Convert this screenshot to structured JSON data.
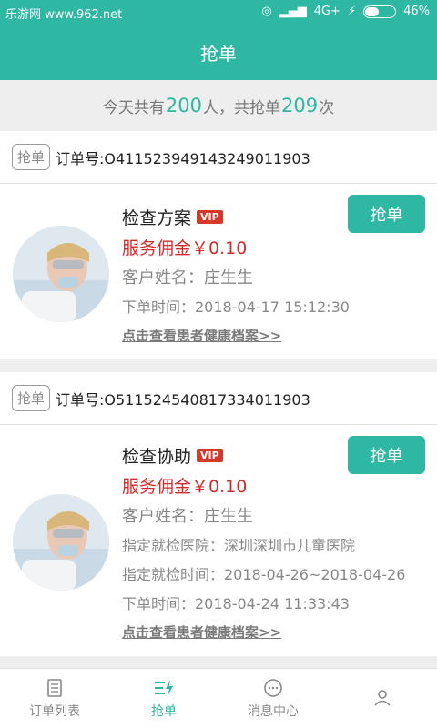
{
  "statusbar": {
    "watermark": "乐游网 www.962.net",
    "network": "4G+",
    "battery": "46%",
    "battery_level": 0.46
  },
  "header": {
    "title": "抢单"
  },
  "summary": {
    "prefix": "今天共有",
    "people": "200",
    "mid": "人，共抢单",
    "times": "209",
    "suffix": "次"
  },
  "orders": [
    {
      "tag": "抢单",
      "order_no": "订单号:O411523949143249011903",
      "title": "检查方案",
      "vip": "VIP",
      "fee": "服务佣金￥0.10",
      "customer": "客户姓名：庄生生",
      "lines": [
        "下单时间：2018-04-17 15:12:30"
      ],
      "link": "点击查看患者健康档案>>",
      "button": "抢单"
    },
    {
      "tag": "抢单",
      "order_no": "订单号:O511524540817334011903",
      "title": "检查协助",
      "vip": "VIP",
      "fee": "服务佣金￥0.10",
      "customer": "客户姓名：庄生生",
      "lines": [
        "指定就检医院：深圳深圳市儿童医院",
        "指定就检时间：2018-04-26~2018-04-26",
        "下单时间：2018-04-24 11:33:43"
      ],
      "link": "点击查看患者健康档案>>",
      "button": "抢单"
    }
  ],
  "tabbar": {
    "tabs": [
      {
        "label": "订单列表",
        "icon": "order-list-icon"
      },
      {
        "label": "抢单",
        "icon": "grab-order-icon"
      },
      {
        "label": "消息中心",
        "icon": "message-icon"
      },
      {
        "label": "",
        "icon": "profile-icon"
      }
    ]
  },
  "colors": {
    "primary": "#2eb7a3",
    "fee": "#d32a2a",
    "vip": "#d43a2a"
  }
}
